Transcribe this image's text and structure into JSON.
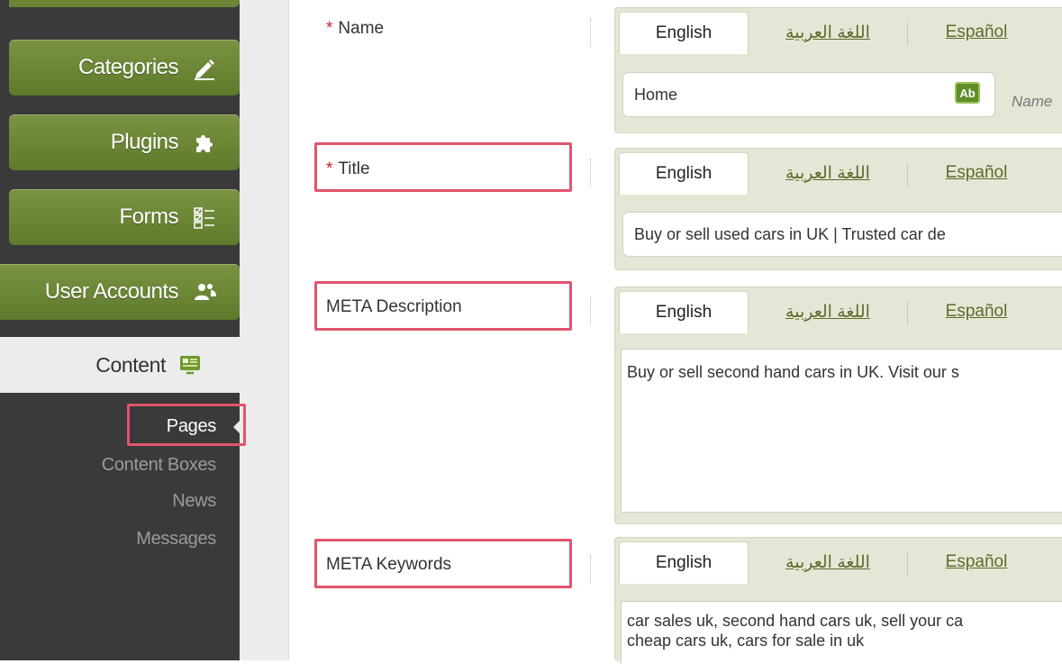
{
  "sidebar": {
    "nav": [
      {
        "label": "Categories",
        "icon": "pencil-icon"
      },
      {
        "label": "Plugins",
        "icon": "puzzle-icon"
      },
      {
        "label": "Forms",
        "icon": "checklist-icon"
      },
      {
        "label": "User Accounts",
        "icon": "users-icon"
      }
    ],
    "active_section": {
      "label": "Content",
      "icon": "monitor-icon"
    },
    "sub_items": [
      "Pages",
      "Content Boxes",
      "News",
      "Messages"
    ],
    "active_sub_item": "Pages"
  },
  "tabs": {
    "english": "English",
    "arabic": "اللغة العربية",
    "spanish": "Español"
  },
  "fields": {
    "name": {
      "label": "Name",
      "required": "*",
      "value": "Home",
      "hint": "Name",
      "icon": "ab-text-icon",
      "icon_text": "Ab"
    },
    "title": {
      "label": "Title",
      "required": "*",
      "value": "Buy or sell used cars in UK | Trusted car de"
    },
    "meta_description": {
      "label": "META Description",
      "value": "Buy or sell second hand cars in UK. Visit our s"
    },
    "meta_keywords": {
      "label": "META Keywords",
      "value_line1": "car sales uk, second hand cars uk, sell your ca",
      "value_line2": "cheap cars uk, cars for sale in uk"
    }
  },
  "colors": {
    "nav_green": "#6e8a37",
    "highlight": "#e2546d",
    "required": "#d0202f"
  }
}
